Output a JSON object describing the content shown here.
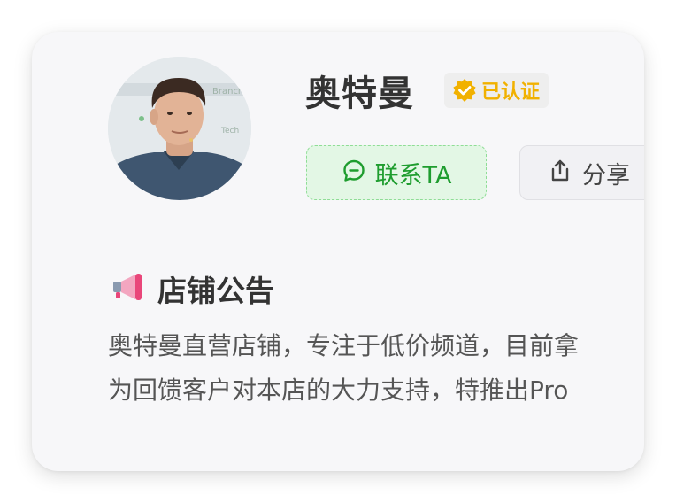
{
  "profile": {
    "name": "奥特曼",
    "verified_label": "已认证",
    "avatar_alt": "store owner avatar"
  },
  "actions": {
    "contact_label": "联系TA",
    "share_label": "分享"
  },
  "notice": {
    "title": "店铺公告",
    "lines": [
      "奥特曼直营店铺，专注于低价频道，目前拿",
      "为回馈客户对本店的大力支持，特推出Pro"
    ]
  },
  "colors": {
    "card_bg": "#f7f7f9",
    "verified_text": "#f1b100",
    "contact_bg": "#e3f7e5",
    "contact_text": "#1f9d2f",
    "megaphone": "#e9467a"
  },
  "icons": {
    "verified": "verified-badge-icon",
    "contact": "chat-bubble-icon",
    "share": "share-icon",
    "notice": "megaphone-icon"
  }
}
